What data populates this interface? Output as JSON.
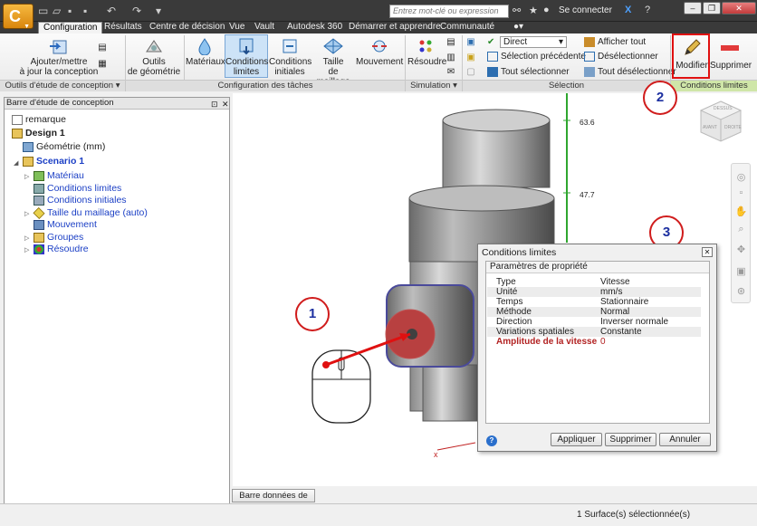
{
  "quick_access": {
    "search_placeholder": "Entrez mot-clé ou expression",
    "signin": "Se connecter"
  },
  "tabs": [
    "Configuration",
    "Résultats",
    "Centre de décision",
    "Vue",
    "Vault",
    "Autodesk 360",
    "Démarrer et apprendre",
    "Communauté"
  ],
  "ribbon": {
    "update_design": "Ajouter/mettre\nà jour la conception",
    "geometry_tools": "Outils\nde géométrie",
    "materials": "Matériaux",
    "boundary_conditions": "Conditions\nlimites",
    "initial_conditions": "Conditions\ninitiales",
    "mesh_size": "Taille\nde maillage",
    "motion": "Mouvement",
    "solve": "Résoudre",
    "direct_mode": "Direct",
    "select_previous": "Sélection précédente",
    "select_all": "Tout sélectionner",
    "show_all": "Afficher tout",
    "deselect": "Désélectionner",
    "deselect_all": "Tout désélectionner",
    "modify": "Modifier",
    "delete": "Supprimer",
    "panels": {
      "design_study_tools": "Outils d'étude de conception",
      "task_setup": "Configuration des tâches",
      "simulation": "Simulation",
      "selection": "Sélection",
      "boundary_conditions": "Conditions limites"
    }
  },
  "left_panel": {
    "title": "Barre d'étude de conception",
    "tree": {
      "note": "remarque",
      "design": "Design 1",
      "geometry": "Géométrie  (mm)",
      "scenario": "Scenario 1",
      "material": "Matériau",
      "boundary_conditions": "Conditions limites",
      "initial_conditions": "Conditions initiales",
      "mesh_size": "Taille du maillage (auto)",
      "motion": "Mouvement",
      "groups": "Groupes",
      "solve": "Résoudre"
    }
  },
  "viewport": {
    "axis_ticks": [
      "63.6",
      "47.7"
    ],
    "viewcube_labels": [
      "DESSUS",
      "DROITE",
      "AVANT"
    ],
    "callouts": [
      "1",
      "2",
      "3"
    ]
  },
  "dialog": {
    "title": "Conditions limites",
    "section": "Paramètres de propriété",
    "properties": [
      {
        "key": "Type",
        "value": "Vitesse"
      },
      {
        "key": "Unité",
        "value": "mm/s"
      },
      {
        "key": "Temps",
        "value": "Stationnaire"
      },
      {
        "key": "Méthode",
        "value": "Normal"
      },
      {
        "key": "Direction",
        "value": "Inverser normale"
      },
      {
        "key": "Variations spatiales",
        "value": "Constante"
      },
      {
        "key": "Amplitude de la vitesse",
        "value": "0"
      }
    ],
    "buttons": {
      "apply": "Appliquer",
      "delete": "Supprimer",
      "cancel": "Annuler"
    }
  },
  "output_bar_button": "Barre données de sortie",
  "status": "1 Surface(s) sélectionnée(s)",
  "colors": {
    "accent_red": "#e01010",
    "callout_blue": "#1c2fa0",
    "selection_face": "#b84040"
  }
}
